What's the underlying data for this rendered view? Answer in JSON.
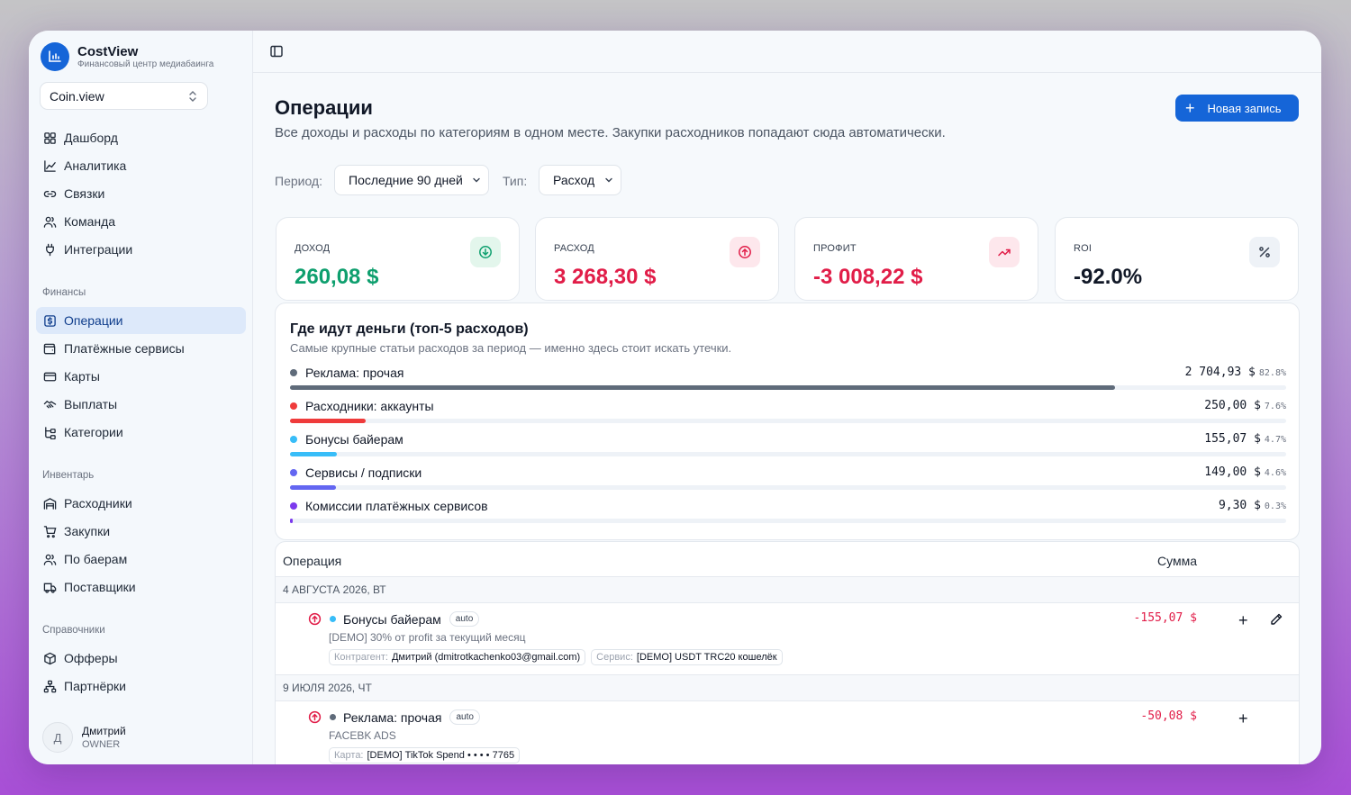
{
  "brand": {
    "title": "CostView",
    "subtitle": "Финансовый центр медиабаинга"
  },
  "workspace": {
    "value": "Coin.view"
  },
  "nav": {
    "main": [
      {
        "label": "Дашборд",
        "icon": "dashboard-icon"
      },
      {
        "label": "Аналитика",
        "icon": "chart-line-icon"
      },
      {
        "label": "Связки",
        "icon": "link-icon"
      },
      {
        "label": "Команда",
        "icon": "users-icon"
      },
      {
        "label": "Интеграции",
        "icon": "plug-icon"
      }
    ],
    "finance_title": "Финансы",
    "finance": [
      {
        "label": "Операции",
        "icon": "dollar-square-icon",
        "active": true
      },
      {
        "label": "Платёжные сервисы",
        "icon": "wallet-icon"
      },
      {
        "label": "Карты",
        "icon": "card-icon"
      },
      {
        "label": "Выплаты",
        "icon": "handshake-icon"
      },
      {
        "label": "Категории",
        "icon": "tree-icon"
      }
    ],
    "inventory_title": "Инвентарь",
    "inventory": [
      {
        "label": "Расходники",
        "icon": "warehouse-icon"
      },
      {
        "label": "Закупки",
        "icon": "cart-icon"
      },
      {
        "label": "По баерам",
        "icon": "users-icon"
      },
      {
        "label": "Поставщики",
        "icon": "truck-icon"
      }
    ],
    "reference_title": "Справочники",
    "reference": [
      {
        "label": "Офферы",
        "icon": "box-icon"
      },
      {
        "label": "Партнёрки",
        "icon": "network-icon"
      }
    ]
  },
  "user": {
    "initial": "Д",
    "name": "Дмитрий",
    "role": "OWNER"
  },
  "page": {
    "title": "Операции",
    "description": "Все доходы и расходы по категориям в одном месте. Закупки расходников попадают сюда автоматически.",
    "new_button": "Новая запись"
  },
  "filters": {
    "period_label": "Период:",
    "period_value": "Последние 90 дней",
    "type_label": "Тип:",
    "type_value": "Расход"
  },
  "stats": [
    {
      "label": "ДОХОД",
      "value": "260,08 $",
      "color": "#0e9f6e",
      "icon": "arrow-down-circle-icon",
      "icon_bg": "#e3f6ec"
    },
    {
      "label": "РАСХОД",
      "value": "3 268,30 $",
      "color": "#e11d48",
      "icon": "arrow-up-circle-icon",
      "icon_bg": "#fde7ec"
    },
    {
      "label": "ПРОФИТ",
      "value": "-3 008,22 $",
      "color": "#e11d48",
      "icon": "trending-up-icon",
      "icon_bg": "#fde7ec"
    },
    {
      "label": "ROI",
      "value": "-92.0%",
      "color": "#111827",
      "icon": "percent-icon",
      "icon_bg": "#eef2f7"
    }
  ],
  "top_expenses": {
    "title": "Где идут деньги (топ-5 расходов)",
    "subtitle": "Самые крупные статьи расходов за период — именно здесь стоит искать утечки.",
    "items": [
      {
        "name": "Реклама: прочая",
        "amount": "2 704,93 $",
        "pct": "82.8%",
        "share": 0.828,
        "color": "#5f6b7a"
      },
      {
        "name": "Расходники: аккаунты",
        "amount": "250,00 $",
        "pct": "7.6%",
        "share": 0.076,
        "color": "#ef3b3b"
      },
      {
        "name": "Бонусы байерам",
        "amount": "155,07 $",
        "pct": "4.7%",
        "share": 0.047,
        "color": "#38bdf8"
      },
      {
        "name": "Сервисы / подписки",
        "amount": "149,00 $",
        "pct": "4.6%",
        "share": 0.046,
        "color": "#6366f1"
      },
      {
        "name": "Комиссии платёжных сервисов",
        "amount": "9,30 $",
        "pct": "0.3%",
        "share": 0.003,
        "color": "#7c3aed"
      }
    ]
  },
  "table": {
    "col_operation": "Операция",
    "col_amount": "Сумма",
    "groups": [
      {
        "date": "4 АВГУСТА 2026, ВТ",
        "op": {
          "category": "Бонусы байерам",
          "dot_color": "#38bdf8",
          "badge": "auto",
          "description": "[DEMO] 30% от profit за текущий месяц",
          "tag1_key": "Контрагент:",
          "tag1_val": "Дмитрий (dmitrotkachenko03@gmail.com)",
          "tag2_key": "Сервис:",
          "tag2_val": "[DEMO] USDT TRC20 кошелёк",
          "amount": "-155,07 $"
        }
      },
      {
        "date": "9 ИЮЛЯ 2026, ЧТ",
        "op": {
          "category": "Реклама: прочая",
          "dot_color": "#5f6b7a",
          "badge": "auto",
          "description": "FACEBK ADS",
          "tag1_key": "Карта:",
          "tag1_val": "[DEMO] TikTok Spend • • • • 7765",
          "amount": "-50,08 $"
        }
      }
    ]
  }
}
